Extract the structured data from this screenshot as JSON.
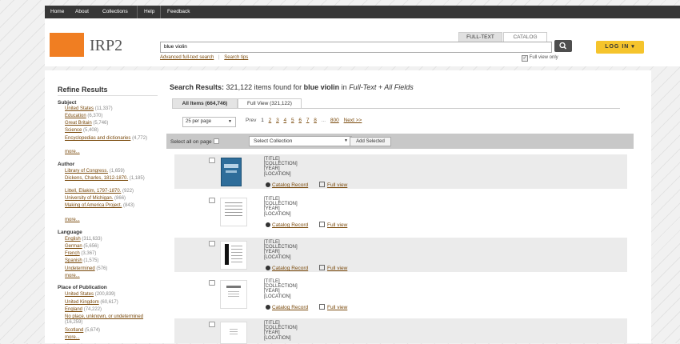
{
  "nav": {
    "items": [
      "Home",
      "About",
      "Collections",
      "Help",
      "Feedback"
    ]
  },
  "brand": {
    "name": "IRP2",
    "color": "#f07e22"
  },
  "search": {
    "tab_fulltext": "FULL-TEXT",
    "tab_catalog": "CATALOG",
    "query": "blue violin",
    "advanced_link": "Advanced full-text search",
    "tips_link": "Search tips",
    "full_view_only": "Full view only"
  },
  "login": {
    "label": "LOG IN"
  },
  "refine": {
    "title": "Refine Results",
    "facets": [
      {
        "heading": "Subject",
        "items": [
          {
            "name": "United States",
            "count": "(11,337)"
          },
          {
            "name": "Education",
            "count": "(6,370)"
          },
          {
            "name": "Great Britain",
            "count": "(5,746)"
          },
          {
            "name": "Science",
            "count": "(5,408)"
          },
          {
            "name": "Encyclopedias and dictionaries",
            "count": "(4,772)"
          }
        ],
        "more": "more..."
      },
      {
        "heading": "Author",
        "items": [
          {
            "name": "Library of Congress.",
            "count": "(1,659)"
          },
          {
            "name": "Dickens, Charles, 1812-1870.",
            "count": "(1,185)"
          },
          {
            "name": "Littell, Eliakim, 1797-1870.",
            "count": "(922)"
          },
          {
            "name": "University of Michigan.",
            "count": "(866)"
          },
          {
            "name": "Making of America Project.",
            "count": "(843)"
          }
        ],
        "more": "more..."
      },
      {
        "heading": "Language",
        "items": [
          {
            "name": "English",
            "count": "(311,633)"
          },
          {
            "name": "German",
            "count": "(5,656)"
          },
          {
            "name": "French",
            "count": "(3,367)"
          },
          {
            "name": "Spanish",
            "count": "(1,575)"
          },
          {
            "name": "Undetermined",
            "count": "(576)"
          }
        ],
        "more": "more..."
      },
      {
        "heading": "Place of Publication",
        "items": [
          {
            "name": "United States",
            "count": "(200,839)"
          },
          {
            "name": "United Kingdom",
            "count": "(60,617)"
          },
          {
            "name": "England",
            "count": "(74,222)"
          },
          {
            "name": "No place, unknown, or undetermined",
            "count": "(16,259)"
          },
          {
            "name": "Scotland",
            "count": "(5,674)"
          }
        ],
        "more": "more..."
      }
    ]
  },
  "results": {
    "label": "Search Results:",
    "count_text": "321,122 items found for",
    "query": "blue violin",
    "in_text": "in",
    "scope": "Full-Text + All Fields",
    "tab_all": "All Items (664,746)",
    "tab_full": "Full View (321,122)",
    "per_page": "25 per page",
    "pager": {
      "prev": "Prev",
      "pages": [
        "1",
        "2",
        "3",
        "4",
        "5",
        "6",
        "7",
        "8"
      ],
      "ellipsis": "...",
      "last": "800",
      "next": "Next >>"
    },
    "select_all": "Select all on page",
    "select_collection": "Select Collection",
    "add_selected": "Add Selected",
    "meta": [
      "[TITLE]",
      "[COLLECTION]",
      "[YEAR]",
      "[LOCATION]"
    ],
    "catalog_record": "Catalog Record",
    "full_view": "Full view",
    "thumbs": [
      "blue-cover",
      "score-page",
      "black-bar-page",
      "title-page",
      "plain-page"
    ]
  }
}
